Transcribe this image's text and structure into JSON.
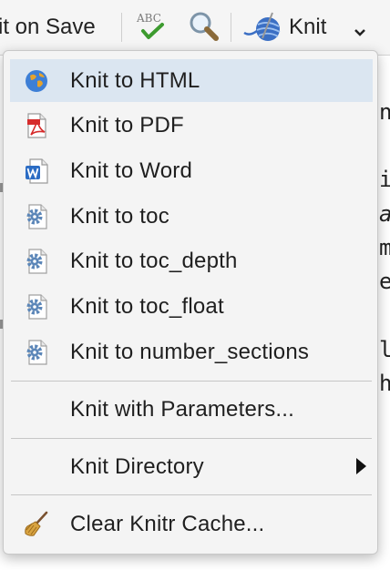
{
  "toolbar": {
    "knit_on_save": "it on Save",
    "spellcheck_glyph": "ABC",
    "knit_label": "Knit"
  },
  "icons": {
    "spellcheck": "spellcheck-icon",
    "search": "magnifier-icon",
    "knit": "yarn-ball-icon",
    "dropdown": "chevron-down-icon"
  },
  "menu": {
    "items": [
      {
        "label": "Knit to HTML",
        "icon": "globe-icon"
      },
      {
        "label": "Knit to PDF",
        "icon": "pdf-icon"
      },
      {
        "label": "Knit to Word",
        "icon": "word-icon"
      },
      {
        "label": "Knit to toc",
        "icon": "gear-doc-icon"
      },
      {
        "label": "Knit to toc_depth",
        "icon": "gear-doc-icon"
      },
      {
        "label": "Knit to toc_float",
        "icon": "gear-doc-icon"
      },
      {
        "label": "Knit to number_sections",
        "icon": "gear-doc-icon"
      }
    ],
    "params_label": "Knit with Parameters...",
    "directory_label": "Knit Directory",
    "clear_cache_label": "Clear Knitr Cache..."
  },
  "editor_peek": {
    "chars": [
      "n",
      "i",
      "a",
      "m",
      "e",
      "l",
      "h"
    ]
  },
  "colors": {
    "selected_bg": "#dbe6f1",
    "menu_bg": "#f4f4f4"
  }
}
